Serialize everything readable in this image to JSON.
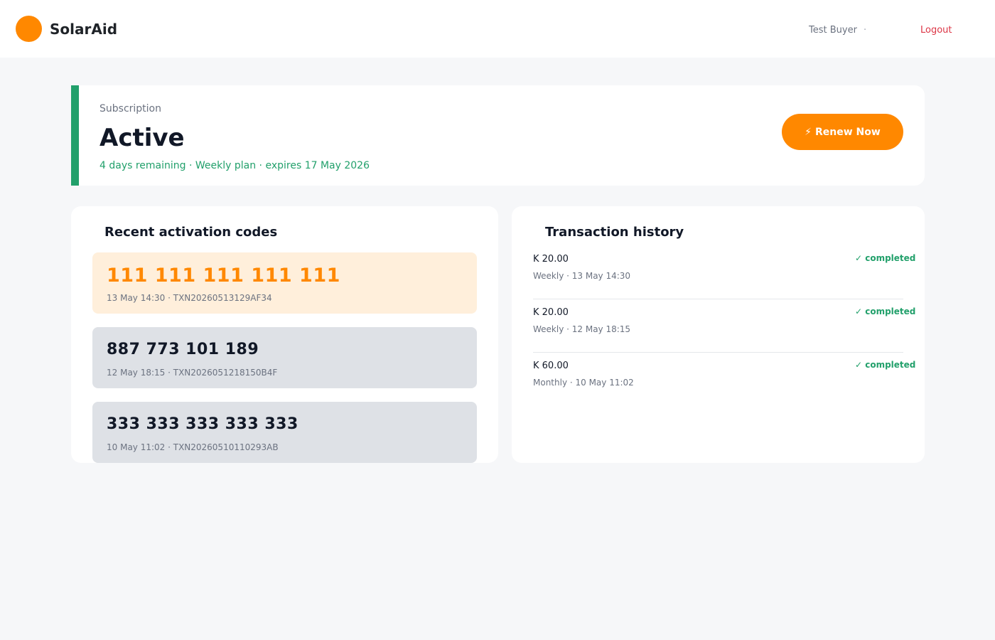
{
  "header": {
    "brand": "SolarAid",
    "user_name": "Test Buyer",
    "separator": "·",
    "logout_label": "Logout"
  },
  "subscription": {
    "label": "Subscription",
    "status": "Active",
    "detail": "4 days remaining · Weekly plan · expires 17 May 2026",
    "renew_icon": "⚡",
    "renew_label": "Renew Now"
  },
  "codes_panel": {
    "title": "Recent activation codes",
    "items": [
      {
        "code": "111 111 111 111 111",
        "meta": "13 May 14:30 · TXN20260513129AF34"
      },
      {
        "code": "887 773 101 189",
        "meta": "12 May 18:15 · TXN2026051218150B4F"
      },
      {
        "code": "333 333 333 333 333",
        "meta": "10 May 11:02 · TXN20260510110293AB"
      }
    ]
  },
  "transactions_panel": {
    "title": "Transaction history",
    "items": [
      {
        "amount": "K 20.00",
        "meta": "Weekly · 13 May 14:30",
        "status": "✓ completed"
      },
      {
        "amount": "K 20.00",
        "meta": "Weekly · 12 May 18:15",
        "status": "✓ completed"
      },
      {
        "amount": "K 60.00",
        "meta": "Monthly · 10 May 11:02",
        "status": "✓ completed"
      }
    ]
  },
  "colors": {
    "brand_orange": "#ff8800",
    "success_green": "#22a06b",
    "logout_red": "#dc3545",
    "page_bg": "#f6f7f9"
  }
}
